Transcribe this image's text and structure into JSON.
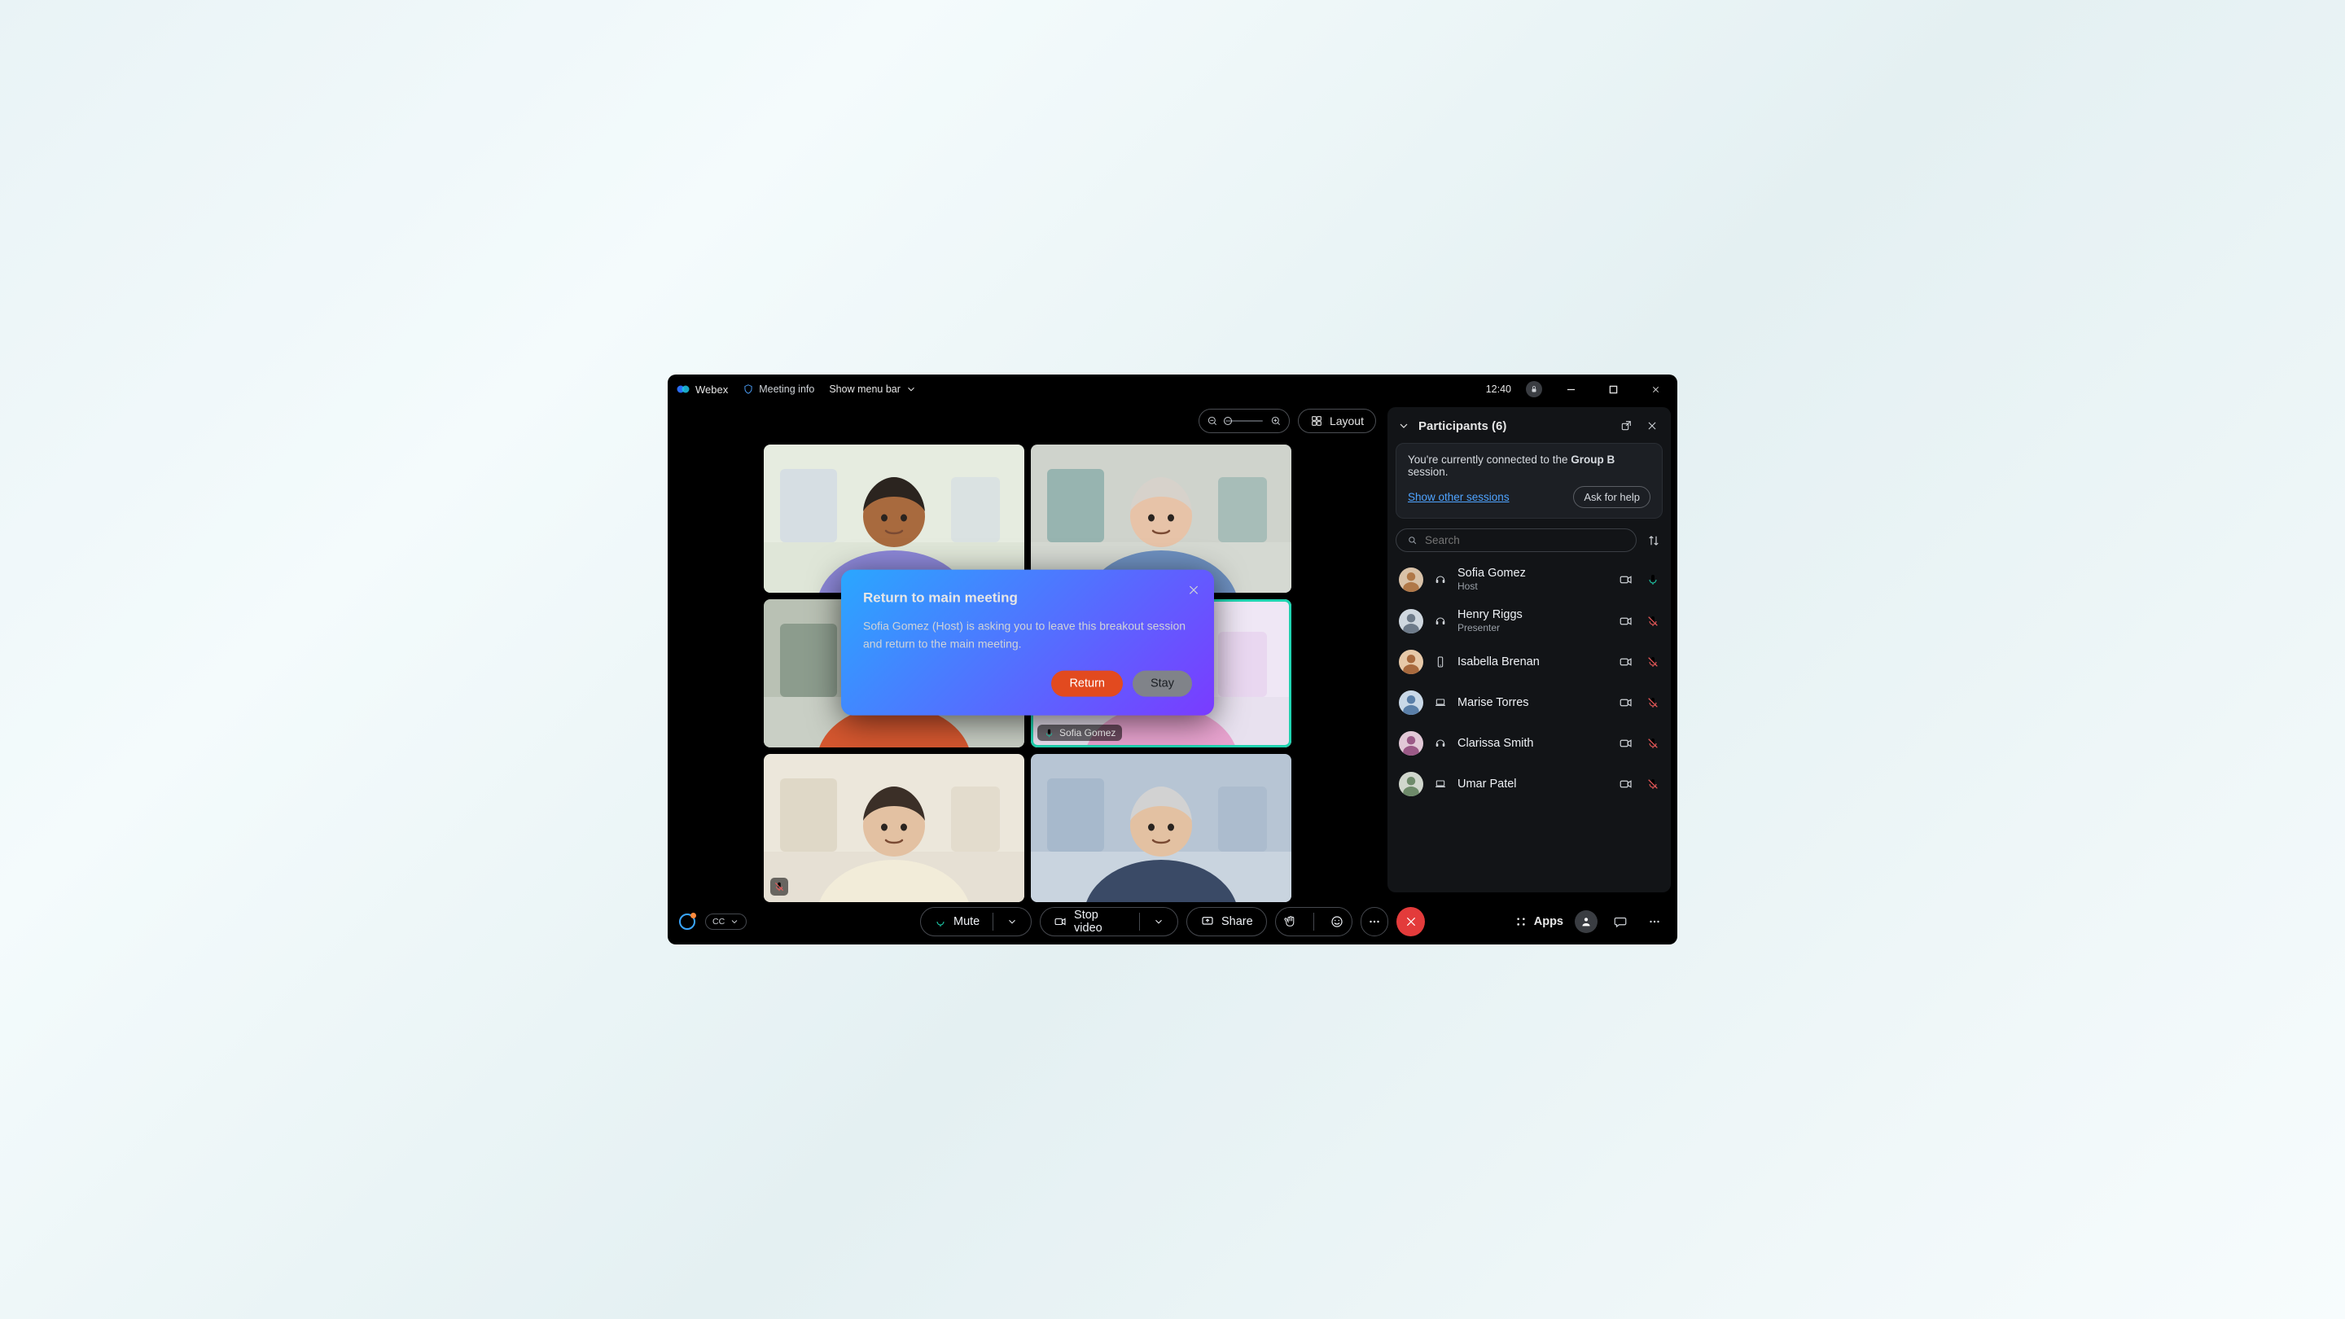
{
  "titlebar": {
    "brand": "Webex",
    "meeting_info": "Meeting info",
    "menubar": "Show menu bar",
    "clock": "12:40"
  },
  "stage": {
    "layout_label": "Layout",
    "active_tile_name": "Sofia Gomez"
  },
  "panel": {
    "title": "Participants (6)",
    "notice_prefix": "You're currently connected to the ",
    "notice_group": "Group B",
    "notice_suffix": " session.",
    "show_other": "Show other sessions",
    "ask_help": "Ask for help",
    "search_placeholder": "Search"
  },
  "participants": [
    {
      "name": "Sofia Gomez",
      "role": "Host",
      "role_icon": "headset",
      "mic": "on"
    },
    {
      "name": "Henry Riggs",
      "role": "Presenter",
      "role_icon": "headset",
      "mic": "off"
    },
    {
      "name": "Isabella Brenan",
      "role": "",
      "role_icon": "phone",
      "mic": "off"
    },
    {
      "name": "Marise Torres",
      "role": "",
      "role_icon": "laptop",
      "mic": "off"
    },
    {
      "name": "Clarissa Smith",
      "role": "",
      "role_icon": "headset",
      "mic": "off"
    },
    {
      "name": "Umar Patel",
      "role": "",
      "role_icon": "laptop",
      "mic": "off"
    }
  ],
  "controls": {
    "cc": "CC",
    "mute": "Mute",
    "stop_video": "Stop video",
    "share": "Share",
    "apps": "Apps"
  },
  "modal": {
    "title": "Return to main meeting",
    "body": "Sofia Gomez (Host) is asking you to leave this breakout session and return to the main meeting.",
    "return": "Return",
    "stay": "Stay"
  },
  "avatar_colors": [
    [
      "#d9c2a8",
      "#b07848"
    ],
    [
      "#cfd7df",
      "#6e7b8a"
    ],
    [
      "#e7c9a8",
      "#a86a3e"
    ],
    [
      "#c9d8e7",
      "#5a7fa8"
    ],
    [
      "#e2c9d7",
      "#9b5a87"
    ],
    [
      "#d0d6cc",
      "#6e8a6a"
    ]
  ],
  "tile_scenes": [
    {
      "bg": "#dfe6d8",
      "wall": "#e6ece0",
      "accent": "#b7c5e8",
      "skin": "#a86a3e",
      "hair": "#2b241f",
      "shirt": "#8b86d6"
    },
    {
      "bg": "#d5d9d2",
      "wall": "#cfd3cc",
      "accent": "#2f7a7a",
      "skin": "#e7c3a8",
      "hair": "#d7d2cb",
      "shirt": "#6d8fbf"
    },
    {
      "bg": "#c9cfc5",
      "wall": "#b9c1b4",
      "accent": "#3a5a46",
      "skin": "#8a542f",
      "hair": "#1d1915",
      "shirt": "#d5572f"
    },
    {
      "bg": "#e8e1ef",
      "wall": "#efe7f5",
      "accent": "#d9a8e2",
      "skin": "#e7c3a8",
      "hair": "#3a2e28",
      "shirt": "#e8a3cf"
    },
    {
      "bg": "#e6e0d4",
      "wall": "#ece7db",
      "accent": "#c8bda4",
      "skin": "#e3c1a2",
      "hair": "#3b2f27",
      "shirt": "#f2ecd9"
    },
    {
      "bg": "#c9d4df",
      "wall": "#b7c5d4",
      "accent": "#8aa3bc",
      "skin": "#e3c1a2",
      "hair": "#d2d2d2",
      "shirt": "#3a4a66"
    }
  ]
}
